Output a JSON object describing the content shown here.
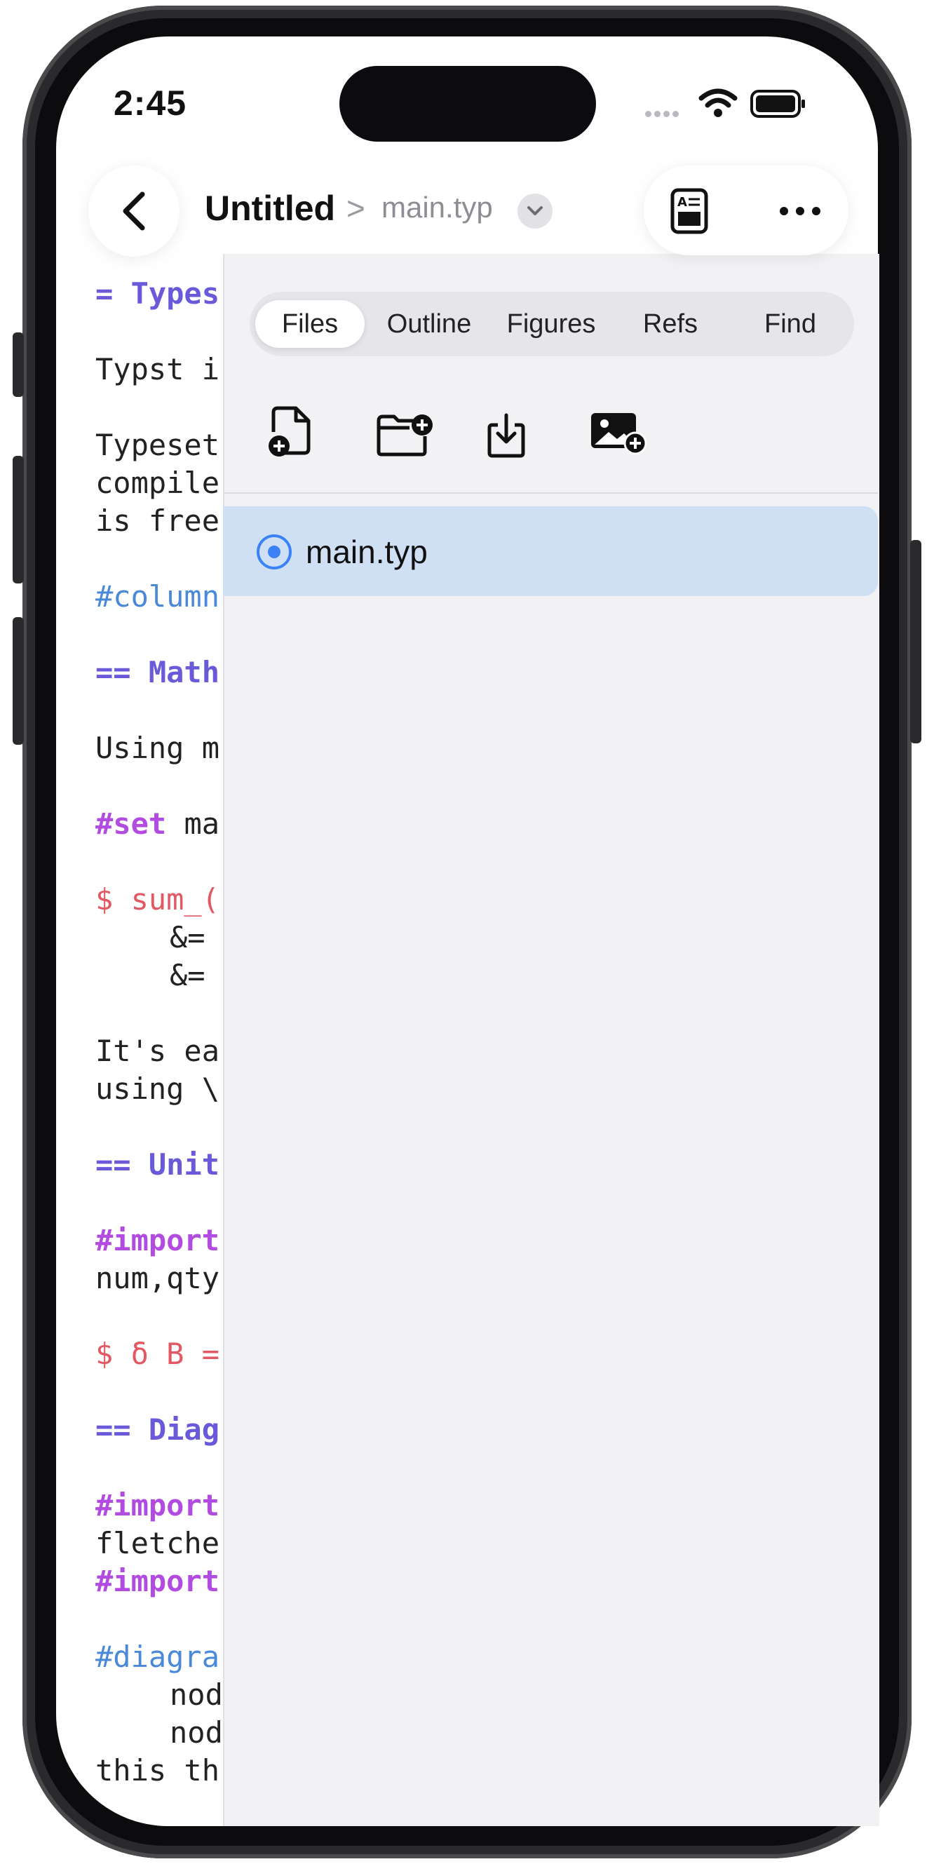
{
  "status_bar": {
    "time": "2:45"
  },
  "toolbar": {
    "project_title": "Untitled",
    "breadcrumb_separator": ">",
    "current_file": "main.typ"
  },
  "panel": {
    "tabs": [
      {
        "label": "Files",
        "selected": true
      },
      {
        "label": "Outline",
        "selected": false
      },
      {
        "label": "Figures",
        "selected": false
      },
      {
        "label": "Refs",
        "selected": false
      },
      {
        "label": "Find",
        "selected": false
      }
    ],
    "actions": [
      "new-file-icon",
      "new-folder-icon",
      "import-file-icon",
      "add-image-icon"
    ],
    "files": [
      {
        "name": "main.typ",
        "selected": true
      }
    ]
  },
  "editor": {
    "lines": [
      "= Types",
      "Typst i",
      "Typeset",
      "compile",
      "is free",
      "#column",
      "== Math",
      "Using m",
      "#set ma",
      "$ sum_(",
      "&=",
      "&=",
      "It's ea",
      "using \\",
      "== Unit",
      "#import",
      "num,qty",
      "$ δ B =",
      "== Diag",
      "#import",
      "fletche",
      "#import",
      "#diagra",
      "nod",
      "nod",
      "this th"
    ]
  },
  "colors": {
    "accent": "#3b82f6",
    "selection": "#cfe0f5",
    "keyword": "#b24be0",
    "heading": "#6a5ad9",
    "function": "#4a89d8",
    "math": "#e25863"
  }
}
